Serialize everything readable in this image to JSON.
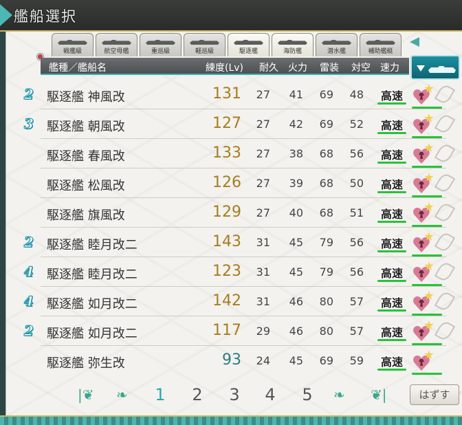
{
  "title": "艦船選択",
  "tabs": [
    {
      "label": "戦艦級",
      "active": false
    },
    {
      "label": "航空母艦",
      "active": false
    },
    {
      "label": "重巡級",
      "active": false
    },
    {
      "label": "軽巡級",
      "active": false
    },
    {
      "label": "駆逐艦",
      "active": true
    },
    {
      "label": "海防艦",
      "active": true
    },
    {
      "label": "潜水艦",
      "active": false
    },
    {
      "label": "補助艦艇",
      "active": false
    }
  ],
  "header": {
    "name": "艦種／艦船名",
    "lv": "練度(Lv)",
    "hp": "耐久",
    "fp": "火力",
    "tp": "雷装",
    "aa": "対空",
    "speed": "速力"
  },
  "ships": [
    {
      "fleet": "2",
      "name": "駆逐艦 神風改",
      "lv": "131",
      "hp": "27",
      "fp": "41",
      "tp": "69",
      "aa": "48",
      "speed": "高速",
      "leaf": true
    },
    {
      "fleet": "3",
      "name": "駆逐艦 朝風改",
      "lv": "127",
      "hp": "27",
      "fp": "42",
      "tp": "69",
      "aa": "52",
      "speed": "高速",
      "leaf": true
    },
    {
      "fleet": "",
      "name": "駆逐艦 春風改",
      "lv": "133",
      "hp": "27",
      "fp": "38",
      "tp": "68",
      "aa": "56",
      "speed": "高速",
      "leaf": true
    },
    {
      "fleet": "",
      "name": "駆逐艦 松風改",
      "lv": "126",
      "hp": "27",
      "fp": "39",
      "tp": "68",
      "aa": "50",
      "speed": "高速",
      "leaf": true
    },
    {
      "fleet": "",
      "name": "駆逐艦 旗風改",
      "lv": "129",
      "hp": "27",
      "fp": "40",
      "tp": "68",
      "aa": "51",
      "speed": "高速",
      "leaf": true
    },
    {
      "fleet": "2",
      "name": "駆逐艦 睦月改二",
      "lv": "143",
      "hp": "31",
      "fp": "45",
      "tp": "79",
      "aa": "56",
      "speed": "高速",
      "leaf": true
    },
    {
      "fleet": "4",
      "name": "駆逐艦 睦月改二",
      "lv": "123",
      "hp": "31",
      "fp": "45",
      "tp": "79",
      "aa": "56",
      "speed": "高速",
      "leaf": true
    },
    {
      "fleet": "4",
      "name": "駆逐艦 如月改二",
      "lv": "142",
      "hp": "31",
      "fp": "46",
      "tp": "80",
      "aa": "57",
      "speed": "高速",
      "leaf": true
    },
    {
      "fleet": "2",
      "name": "駆逐艦 如月改二",
      "lv": "117",
      "hp": "29",
      "fp": "46",
      "tp": "80",
      "aa": "57",
      "speed": "高速",
      "leaf": true
    },
    {
      "fleet": "",
      "name": "駆逐艦 弥生改",
      "lv": "93",
      "hp": "24",
      "fp": "45",
      "tp": "69",
      "aa": "59",
      "speed": "高速",
      "leaf": false
    }
  ],
  "pager": {
    "pages": [
      "1",
      "2",
      "3",
      "4",
      "5"
    ],
    "current": "1",
    "first_icon": "first-page-icon",
    "prev_icon": "prev-page-icon",
    "next_icon": "next-page-icon",
    "last_icon": "last-page-icon",
    "remove_label": "はずす"
  },
  "colors": {
    "accent": "#2aa7b0",
    "level": "#a67c20",
    "speed_bar": "#27c23a"
  }
}
